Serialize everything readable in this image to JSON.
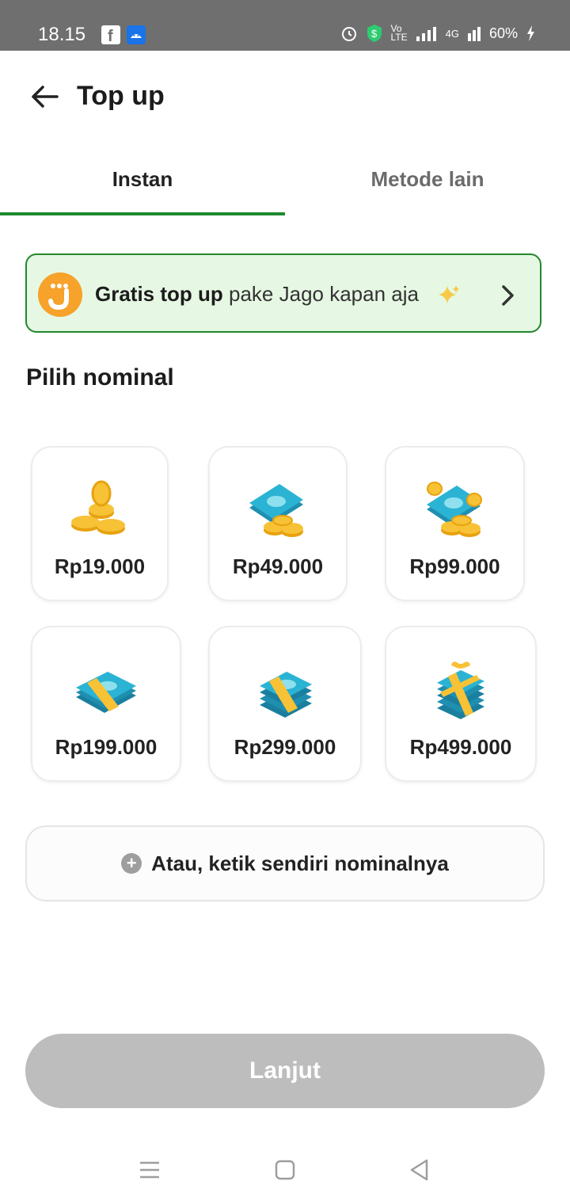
{
  "status_bar": {
    "time": "18.15",
    "battery": "60%",
    "network": "4G"
  },
  "header": {
    "title": "Top up"
  },
  "tabs": [
    {
      "label": "Instan",
      "active": true
    },
    {
      "label": "Metode lain",
      "active": false
    }
  ],
  "promo": {
    "bold": "Gratis top up",
    "rest": " pake Jago kapan aja"
  },
  "section_title": "Pilih nominal",
  "amounts": [
    {
      "label": "Rp19.000",
      "icon": "coins-icon"
    },
    {
      "label": "Rp49.000",
      "icon": "cash-coins-icon"
    },
    {
      "label": "Rp99.000",
      "icon": "cash-many-coins-icon"
    },
    {
      "label": "Rp199.000",
      "icon": "banknote-bundle-icon"
    },
    {
      "label": "Rp299.000",
      "icon": "banknote-stack-icon"
    },
    {
      "label": "Rp499.000",
      "icon": "banknote-gift-icon"
    }
  ],
  "custom_amount": "Atau, ketik sendiri nominalnya",
  "cta": "Lanjut",
  "colors": {
    "accent_green": "#1f8a2e",
    "promo_bg": "#e6f8e3",
    "cta_disabled": "#bdbdbd",
    "jago_orange": "#f6a22b"
  }
}
